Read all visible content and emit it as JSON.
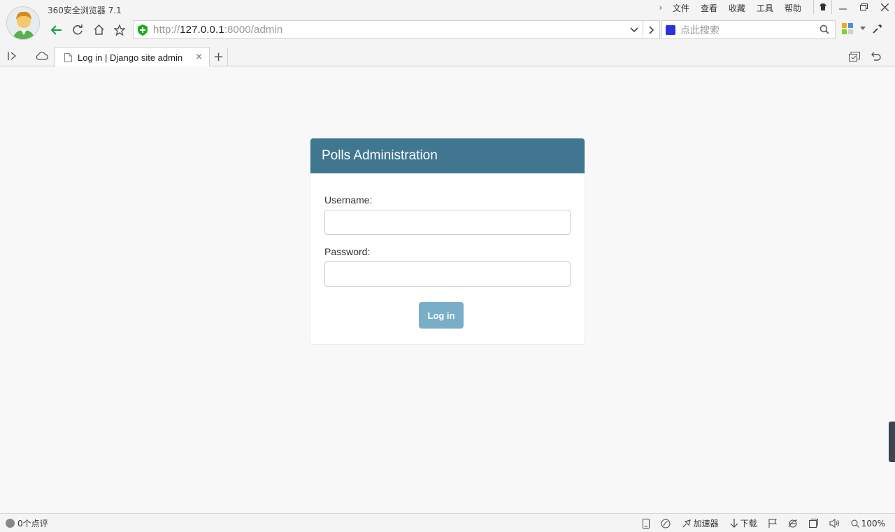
{
  "browser": {
    "app_title": "360安全浏览器 7.1",
    "menus": [
      "文件",
      "查看",
      "收藏",
      "工具",
      "帮助"
    ],
    "address": {
      "scheme": "http://",
      "host": "127.0.0.1",
      "rest": ":8000/admin"
    },
    "search_placeholder": "点此搜索",
    "tab_title": "Log in | Django site admin",
    "new_tab_label": "+",
    "tab_close": "×"
  },
  "login": {
    "header": "Polls Administration",
    "username_label": "Username:",
    "password_label": "Password:",
    "username_value": "",
    "password_value": "",
    "submit_label": "Log in"
  },
  "statusbar": {
    "comments": "0个点评",
    "accelerator": "加速器",
    "download": "下载",
    "zoom": "100%"
  },
  "colors": {
    "header_bg": "#417690",
    "button_bg": "#79aec8",
    "accent_green": "#1aad19"
  }
}
